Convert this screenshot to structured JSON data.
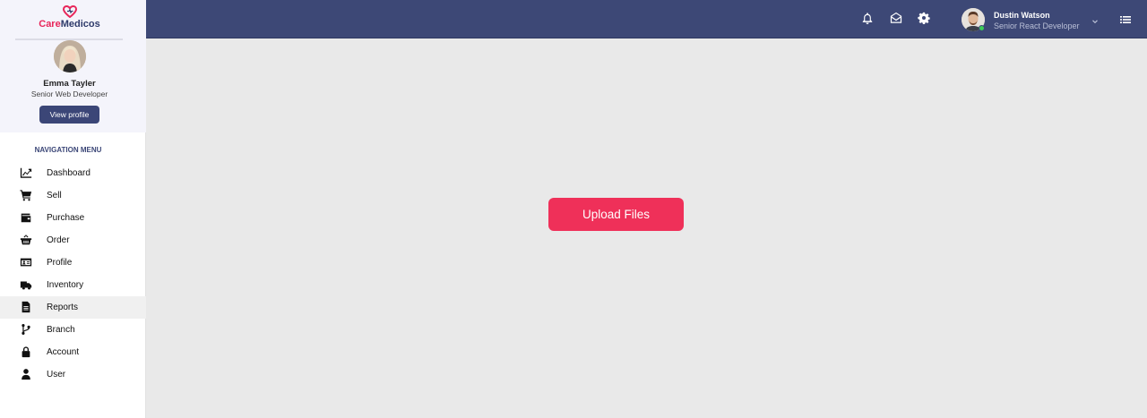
{
  "brand": {
    "care": "Care",
    "medicos": "Medicos"
  },
  "sidebar_profile": {
    "name": "Emma Tayler",
    "role": "Senior Web Developer",
    "view_profile_label": "View profile"
  },
  "nav": {
    "title": "NAVIGATION MENU",
    "active": "Reports",
    "items": [
      {
        "label": "Dashboard",
        "icon": "chart-line-icon"
      },
      {
        "label": "Sell",
        "icon": "cart-icon"
      },
      {
        "label": "Purchase",
        "icon": "wallet-icon"
      },
      {
        "label": "Order",
        "icon": "basket-icon"
      },
      {
        "label": "Profile",
        "icon": "id-card-icon"
      },
      {
        "label": "Inventory",
        "icon": "truck-icon"
      },
      {
        "label": "Reports",
        "icon": "file-icon"
      },
      {
        "label": "Branch",
        "icon": "code-branch-icon"
      },
      {
        "label": "Account",
        "icon": "lock-icon"
      },
      {
        "label": "User",
        "icon": "user-icon"
      }
    ]
  },
  "header": {
    "user_name": "Dustin Watson",
    "user_role": "Senior React Developer",
    "icons": [
      "bell-icon",
      "envelope-open-icon",
      "gear-icon",
      "chevron-down-icon",
      "list-icon"
    ]
  },
  "main": {
    "upload_label": "Upload Files"
  },
  "colors": {
    "header_bg": "#3d4876",
    "accent": "#ef3059",
    "button_primary": "#3b4677",
    "online": "#3ccd57",
    "page_bg": "#e9e9e9"
  }
}
